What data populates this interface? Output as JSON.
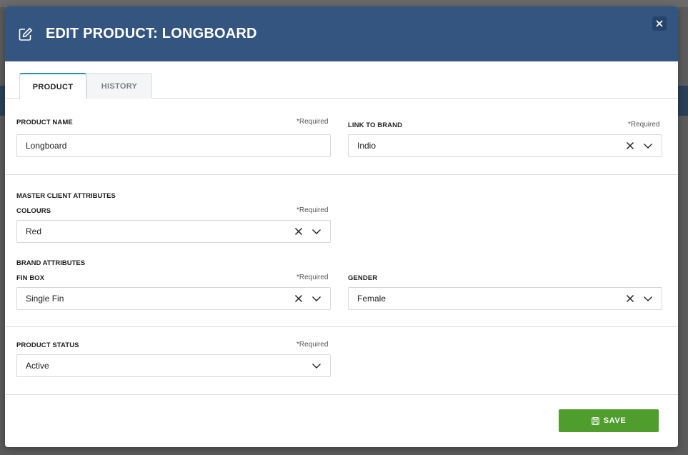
{
  "modal": {
    "title": "EDIT PRODUCT: LONGBOARD"
  },
  "tabs": [
    {
      "label": "PRODUCT",
      "active": true
    },
    {
      "label": "HISTORY",
      "active": false
    }
  ],
  "product_section": {
    "product_name": {
      "label": "PRODUCT NAME",
      "required": "*Required",
      "value": "Longboard"
    },
    "link_to_brand": {
      "label": "LINK TO BRAND",
      "required": "*Required",
      "value": "Indio"
    }
  },
  "attributes_section": {
    "master_client_title": "MASTER CLIENT ATTRIBUTES",
    "colours": {
      "label": "COLOURS",
      "required": "*Required",
      "value": "Red"
    },
    "brand_title": "BRAND ATTRIBUTES",
    "fin_box": {
      "label": "FIN BOX",
      "required": "*Required",
      "value": "Single Fin"
    },
    "gender": {
      "label": "GENDER",
      "value": "Female"
    }
  },
  "status_section": {
    "product_status": {
      "label": "PRODUCT STATUS",
      "required": "*Required",
      "value": "Active"
    }
  },
  "footer": {
    "save_label": "SAVE"
  },
  "colors": {
    "header": "#33557f",
    "tab_accent": "#2a8fb6",
    "save": "#4f9d2d"
  }
}
